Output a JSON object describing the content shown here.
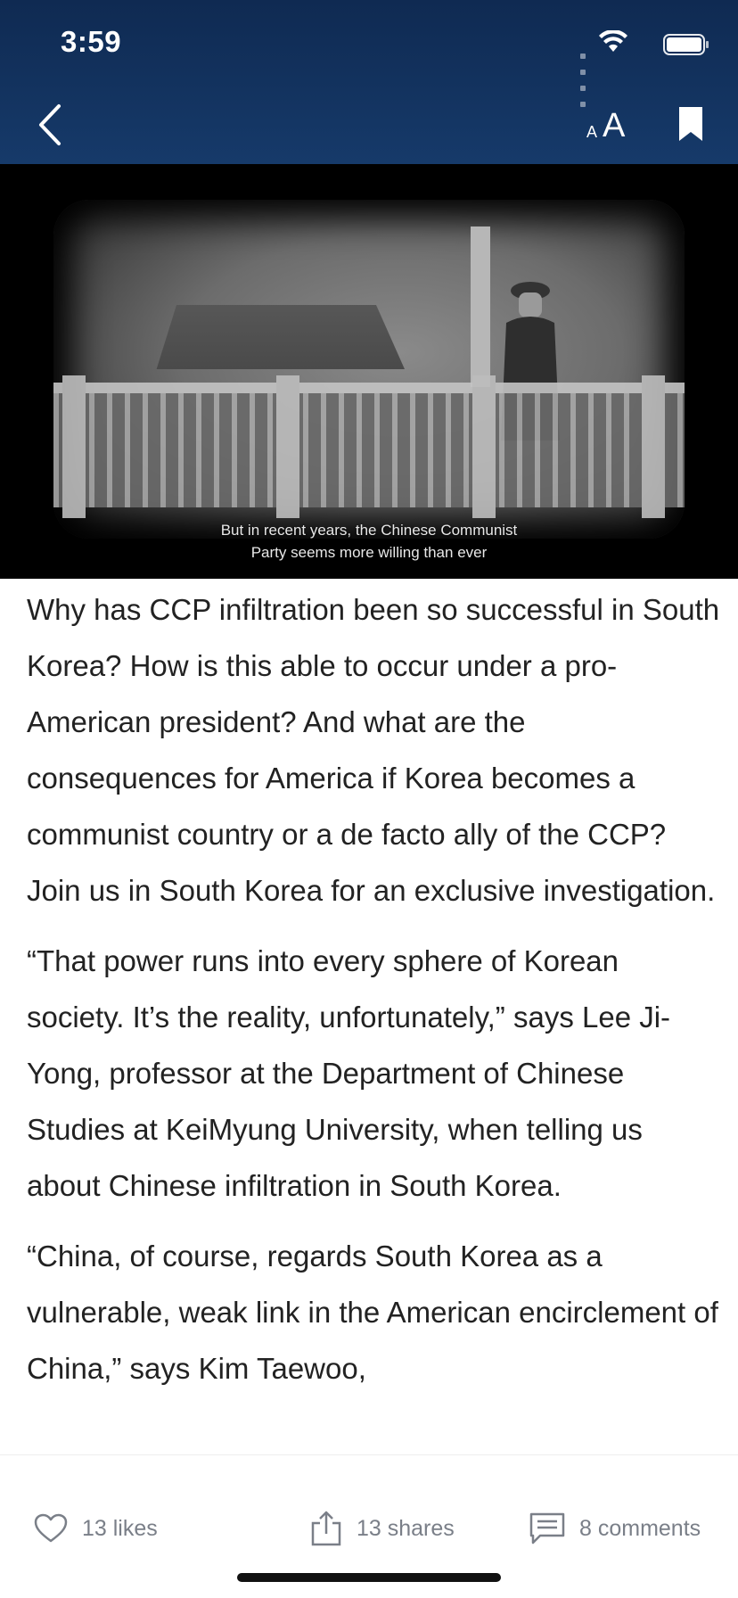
{
  "status_bar": {
    "time": "3:59"
  },
  "header": {
    "back_icon": "chevron-left-icon",
    "font_size": {
      "small": "A",
      "large": "A"
    },
    "bookmark_icon": "bookmark-icon"
  },
  "video": {
    "subtitle_line1": "But in recent years, the Chinese Communist",
    "subtitle_line2": "Party seems more willing than ever"
  },
  "article": {
    "paragraphs": [
      "Why has CCP infiltration been so successful in South Korea? How is this able to occur under a pro-American president? And what are the consequences for America if Korea becomes a communist country or a de facto ally of the CCP? Join us in South Korea for an exclusive investigation.",
      "“That power runs into every sphere of Korean society. It’s the reality, unfortunately,” says Lee Ji-Yong, professor at the Department of Chinese Studies at KeiMyung University, when telling us about Chinese infiltration in South Korea.",
      "“China, of course, regards South Korea as a vulnerable, weak link in the American encirclement of China,” says Kim Taewoo,"
    ]
  },
  "actions": {
    "likes": "13 likes",
    "shares": "13 shares",
    "comments": "8 comments"
  },
  "colors": {
    "header_bg": "#163a6a",
    "action_text": "#7a7f88"
  }
}
